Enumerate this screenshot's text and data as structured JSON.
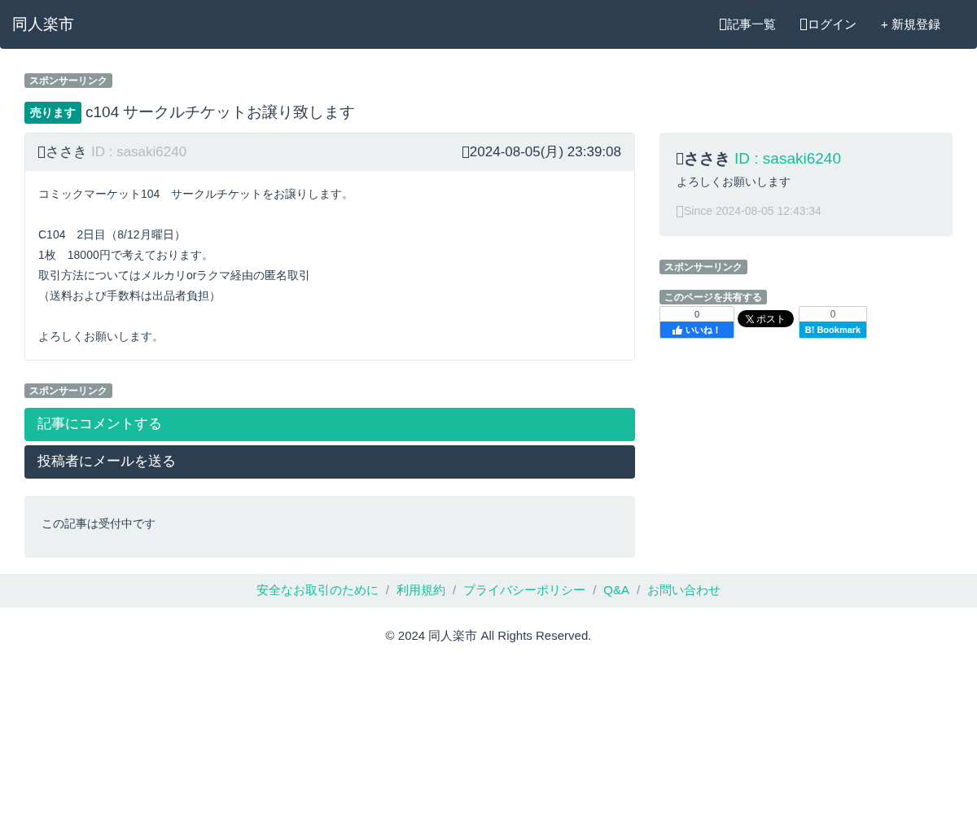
{
  "navbar": {
    "brand": "同人楽市",
    "links": [
      {
        "label": "記事一覧",
        "icon": true
      },
      {
        "label": "ログイン",
        "icon": true
      },
      {
        "label": "+ 新規登録",
        "icon": false
      }
    ]
  },
  "sponsor_top": "スポンサーリンク",
  "post": {
    "tag": "売ります",
    "title": "c104 サークルチケットお譲り致します",
    "author": "ささき",
    "author_id": "ID : sasaki6240",
    "date": "2024-08-05(月) 23:39:08",
    "paragraphs": [
      [
        "コミックマーケット104　サークルチケットをお譲りします。"
      ],
      [
        "C104　2日目（8/12月曜日）",
        "1枚　18000円で考えております。",
        "取引方法についてはメルカリorラクマ経由の匿名取引",
        "（送料および手数料は出品者負担）"
      ],
      [
        "よろしくお願いします。"
      ]
    ]
  },
  "sponsor_middle": "スポンサーリンク",
  "buttons": [
    {
      "label": "記事にコメントする",
      "kind": "primary"
    },
    {
      "label": "投稿者にメールを送る",
      "kind": "dark"
    }
  ],
  "status_note": "この記事は受付中です",
  "profile": {
    "name": "ささき",
    "id": "ID : sasaki6240",
    "bio": "よろしくお願いします",
    "since": "Since 2024-08-05 12:43:34"
  },
  "sponsor_side": "スポンサーリンク",
  "share": {
    "heading": "このページを共有する",
    "facebook_count": "0",
    "facebook_label": "いいね！",
    "x_label": "ポスト",
    "hatena_count": "0",
    "hatena_logo": "B!",
    "hatena_label": "Bookmark"
  },
  "footer_links": {
    "separator": "/",
    "items": [
      "安全なお取引のために",
      "利用規約",
      "プライバシーポリシー",
      "Q&A",
      "お問い合わせ"
    ]
  },
  "copyright": "© 2024 同人楽市 All Rights Reserved."
}
